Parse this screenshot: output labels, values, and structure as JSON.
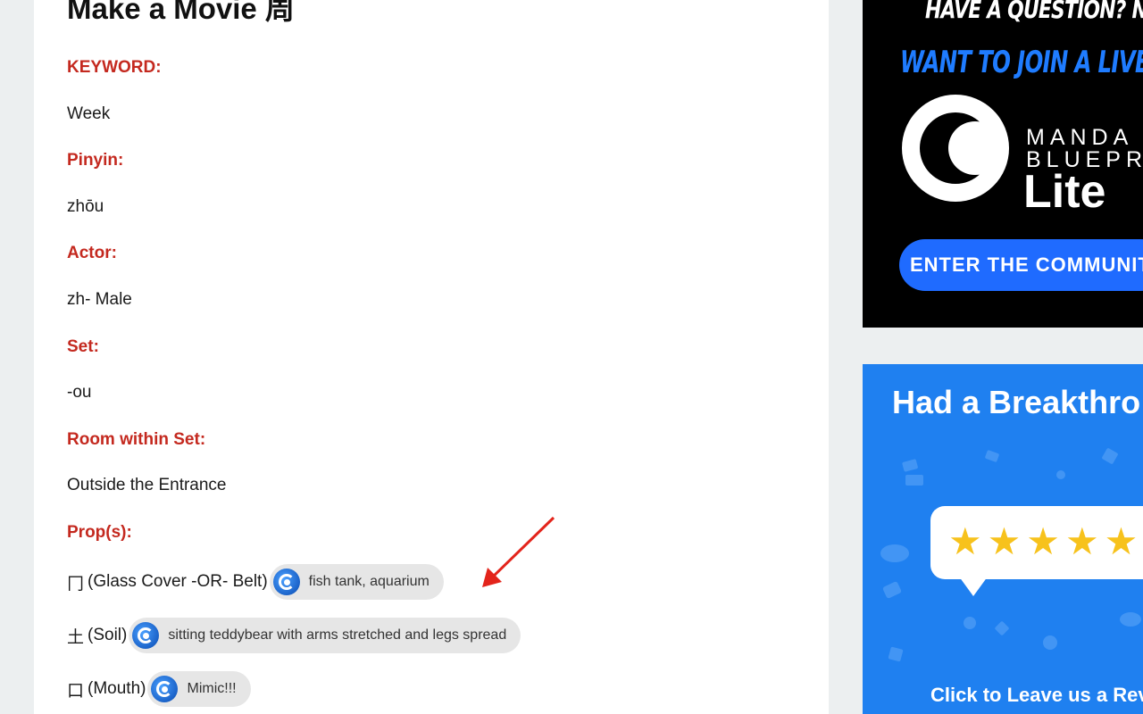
{
  "article": {
    "title": "Make a Movie 周",
    "fields": [
      {
        "label": "KEYWORD:",
        "value": "Week"
      },
      {
        "label": "Pinyin:",
        "value": "zhōu"
      },
      {
        "label": "Actor:",
        "value": "zh- Male"
      },
      {
        "label": "Set:",
        "value": "-ou"
      },
      {
        "label": "Room within Set:",
        "value": "Outside the Entrance"
      }
    ],
    "props_label": "Prop(s):",
    "props": [
      {
        "glyph": "冂",
        "text": "(Glass Cover -OR- Belt)",
        "chip": "fish tank, aquarium"
      },
      {
        "glyph": "土",
        "text": "(Soil)",
        "chip": "sitting teddybear with arms stretched and legs spread"
      },
      {
        "glyph": "口",
        "text": "(Mouth)",
        "chip": "Mimic!!!"
      }
    ]
  },
  "ads": {
    "community": {
      "question": "HAVE A QUESTION? NEED HE",
      "live_event": "WANT TO JOIN A LIVE EVENT? (",
      "brand_line1": "MANDA",
      "brand_line2": "BLUEPR",
      "brand_lite": "Lite",
      "cta": "ENTER THE COMMUNITY"
    },
    "review": {
      "title": "Had a Breakthro",
      "stars": "★★★★★",
      "cta": "Click to Leave us a Revi"
    }
  },
  "colors": {
    "label_red": "#c4291f",
    "ad_blue": "#1f80f0",
    "cta_blue": "#1f6bff",
    "star_yellow": "#f7c21c",
    "annotation_arrow": "#e3241b"
  }
}
